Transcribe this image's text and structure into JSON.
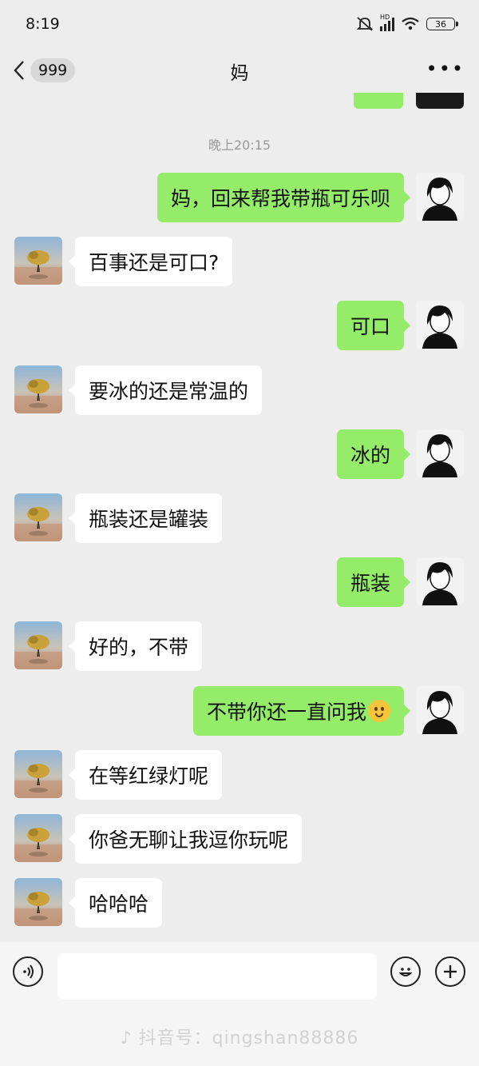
{
  "status_bar": {
    "time": "8:19",
    "battery": "36",
    "network": "HD"
  },
  "header": {
    "title": "妈",
    "unread_count": "999"
  },
  "chat": {
    "timestamp": "晚上20:15",
    "messages": [
      {
        "side": "out",
        "text": "妈，回来帮我带瓶可乐呗"
      },
      {
        "side": "in",
        "text": "百事还是可口?"
      },
      {
        "side": "out",
        "text": "可口"
      },
      {
        "side": "in",
        "text": "要冰的还是常温的"
      },
      {
        "side": "out",
        "text": "冰的"
      },
      {
        "side": "in",
        "text": "瓶装还是罐装"
      },
      {
        "side": "out",
        "text": "瓶装"
      },
      {
        "side": "in",
        "text": "好的，不带"
      },
      {
        "side": "out",
        "text": "不带你还一直问我",
        "emoji": "grimacing-face-emoji"
      },
      {
        "side": "in",
        "text": "在等红绿灯呢"
      },
      {
        "side": "in",
        "text": "你爸无聊让我逗你玩呢"
      },
      {
        "side": "in",
        "text": "哈哈哈"
      }
    ]
  },
  "input_bar": {
    "placeholder": "",
    "watermark": "抖音号：qingshan88886"
  },
  "colors": {
    "background": "#ededed",
    "incoming_bubble": "#ffffff",
    "outgoing_bubble": "#95ec69"
  }
}
